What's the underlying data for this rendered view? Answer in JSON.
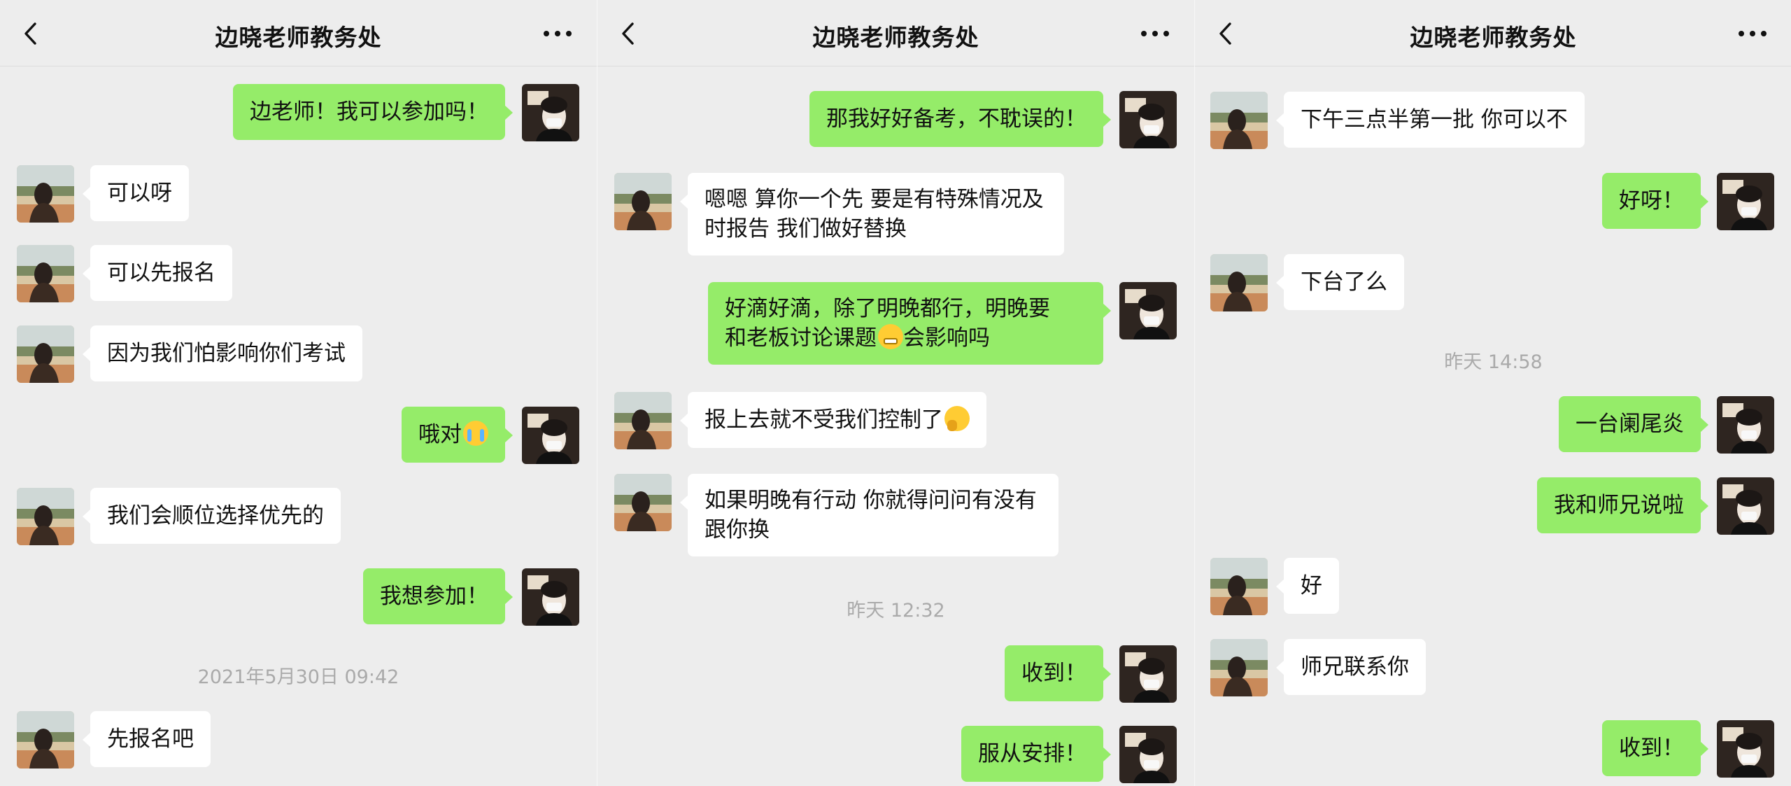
{
  "chat_title": "边晓老师教务处",
  "colors": {
    "background": "#ededed",
    "outgoing_bubble": "#95ec69",
    "incoming_bubble": "#ffffff",
    "timestamp": "#aaaaaa"
  },
  "icons": {
    "back": "chevron-left-icon",
    "more": "more-dots-icon"
  },
  "panel1": {
    "messages": [
      {
        "from": "me",
        "text": "边老师！我可以参加吗！"
      },
      {
        "from": "teacher",
        "text": "可以呀"
      },
      {
        "from": "teacher",
        "text": "可以先报名"
      },
      {
        "from": "teacher",
        "text": "因为我们怕影响你们考试"
      },
      {
        "from": "me",
        "text": "哦对",
        "emoji": "crying-face-emoji"
      },
      {
        "from": "teacher",
        "text": "我们会顺位选择优先的"
      },
      {
        "from": "me",
        "text": "我想参加！"
      },
      {
        "from": "teacher",
        "text": "先报名吧"
      }
    ],
    "timestamp": "2021年5月30日 09:42"
  },
  "panel2": {
    "messages": [
      {
        "from": "me",
        "text": "那我好好备考，不耽误的！"
      },
      {
        "from": "teacher",
        "line1": "嗯嗯 算你一个先 要是有特殊情况及",
        "line2": "时报告 我们做好替换"
      },
      {
        "from": "me",
        "line1": "好滴好滴，除了明晚都行，明晚要",
        "line2": "和老板讨论课题",
        "line2_after_emoji": "会影响吗",
        "emoji": "grimacing-face-emoji"
      },
      {
        "from": "teacher",
        "text": "报上去就不受我们控制了",
        "emoji": "thinking-face-emoji"
      },
      {
        "from": "teacher",
        "line1": "如果明晚有行动 你就得问问有没有",
        "line2": "跟你换"
      },
      {
        "from": "me",
        "text": "收到！"
      },
      {
        "from": "me",
        "text": "服从安排！"
      }
    ],
    "timestamp": "昨天 12:32"
  },
  "panel3": {
    "messages": [
      {
        "from": "teacher",
        "text": "下午三点半第一批 你可以不"
      },
      {
        "from": "me",
        "text": "好呀！"
      },
      {
        "from": "teacher",
        "text": "下台了么"
      },
      {
        "from": "me",
        "text": "一台阑尾炎"
      },
      {
        "from": "me",
        "text": "我和师兄说啦"
      },
      {
        "from": "teacher",
        "text": "好"
      },
      {
        "from": "teacher",
        "text": "师兄联系你"
      },
      {
        "from": "me",
        "text": "收到！"
      }
    ],
    "timestamp": "昨天 14:58"
  }
}
